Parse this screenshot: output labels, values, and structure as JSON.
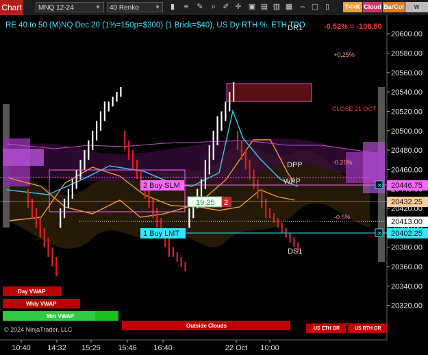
{
  "toolbar": {
    "chart_tab": "Chart",
    "instrument": "MNQ 12-24",
    "bar_type": "40 Renko",
    "buttons": [
      "T<>K",
      "Cloud",
      "BarCol",
      "W VWVA"
    ],
    "colors": {
      "tk": "#e8a13a",
      "cloud": "#d9306b",
      "barcol": "#e07a1f",
      "wvwva": "#bbbbbb"
    }
  },
  "header": {
    "title": "RE 40 to 50 (M)NQ Dec 20 (1%=150p=$300) (1 Brick=$40), US Dy RTH %, ETH TPO",
    "change": "-0.52% = -106.50"
  },
  "chart_data": {
    "type": "candlestick",
    "ylim": [
      20300,
      20610
    ],
    "y_ticks": [
      20320,
      20340,
      20360,
      20380,
      20400,
      20420,
      20440,
      20460,
      20480,
      20500,
      20520,
      20540,
      20560,
      20580,
      20600
    ],
    "x_tick_labels": [
      "10:40",
      "14:32",
      "15:25",
      "15:46",
      "16:40",
      "22 Oct",
      "10:00"
    ],
    "bricks": [
      {
        "open": 20440,
        "close": 20400
      },
      {
        "open": 20400,
        "close": 20360
      },
      {
        "open": 20400,
        "close": 20440
      },
      {
        "open": 20440,
        "close": 20480
      },
      {
        "open": 20480,
        "close": 20520
      },
      {
        "open": 20520,
        "close": 20540
      },
      {
        "open": 20500,
        "close": 20460
      },
      {
        "open": 20460,
        "close": 20420
      },
      {
        "open": 20420,
        "close": 20380
      },
      {
        "open": 20380,
        "close": 20360
      },
      {
        "open": 20400,
        "close": 20440
      },
      {
        "open": 20440,
        "close": 20500
      },
      {
        "open": 20500,
        "close": 20540
      },
      {
        "open": 20500,
        "close": 20460
      },
      {
        "open": 20460,
        "close": 20420
      },
      {
        "open": 20420,
        "close": 20400
      },
      {
        "open": 20400,
        "close": 20380
      }
    ],
    "price_levels": [
      {
        "label": "2 Buy SLM",
        "value": 20446.75,
        "color": "#ff66ff"
      },
      {
        "label": "",
        "value": 20432.25,
        "color": "#ffcc99"
      },
      {
        "label": "",
        "value": 20413.0,
        "color": "#ffffff"
      },
      {
        "label": "1 Buy LMT",
        "value": 20402.25,
        "color": "#33e6ff"
      }
    ],
    "annotations": [
      "DR1",
      "+0.25%",
      "CLOSE 21 OCT",
      "DPP",
      "-0.25%",
      "WPP",
      "-0.5%",
      "DS1",
      "-1.0%"
    ],
    "position_box": {
      "value": "19.25",
      "count": "2"
    },
    "panel_labels": [
      "Day VWAP",
      "Wkly VWAP",
      "Mnt VWAP",
      "Outside Clouds",
      "US ETH OR",
      "US RTH OR"
    ],
    "copyright": "© 2024 NinjaTrader, LLC"
  }
}
